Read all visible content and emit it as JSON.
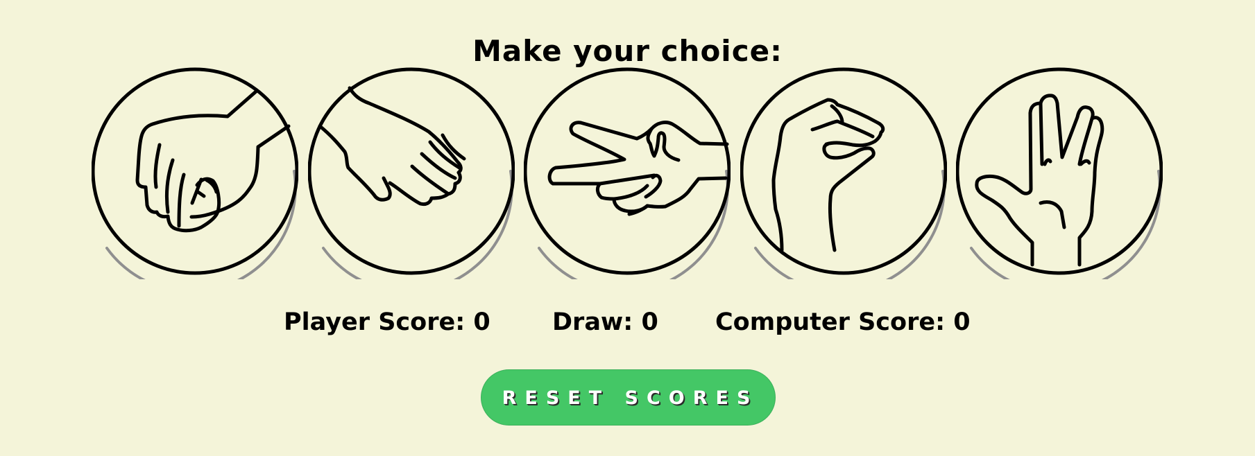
{
  "header": {
    "title": "Make your choice:"
  },
  "choices": [
    {
      "name": "rock",
      "icon": "rock-hand-icon"
    },
    {
      "name": "paper",
      "icon": "paper-hand-icon"
    },
    {
      "name": "scissors",
      "icon": "scissors-hand-icon"
    },
    {
      "name": "lizard",
      "icon": "lizard-hand-icon"
    },
    {
      "name": "spock",
      "icon": "spock-hand-icon"
    }
  ],
  "scores": {
    "player_label": "Player Score: 0",
    "draw_label": "Draw: 0",
    "computer_label": "Computer Score: 0"
  },
  "reset": {
    "label": "RESET SCORES"
  },
  "colors": {
    "background": "#f4f4d9",
    "button": "#44c766",
    "stroke": "#000000",
    "shadow": "#8f8f8f"
  }
}
